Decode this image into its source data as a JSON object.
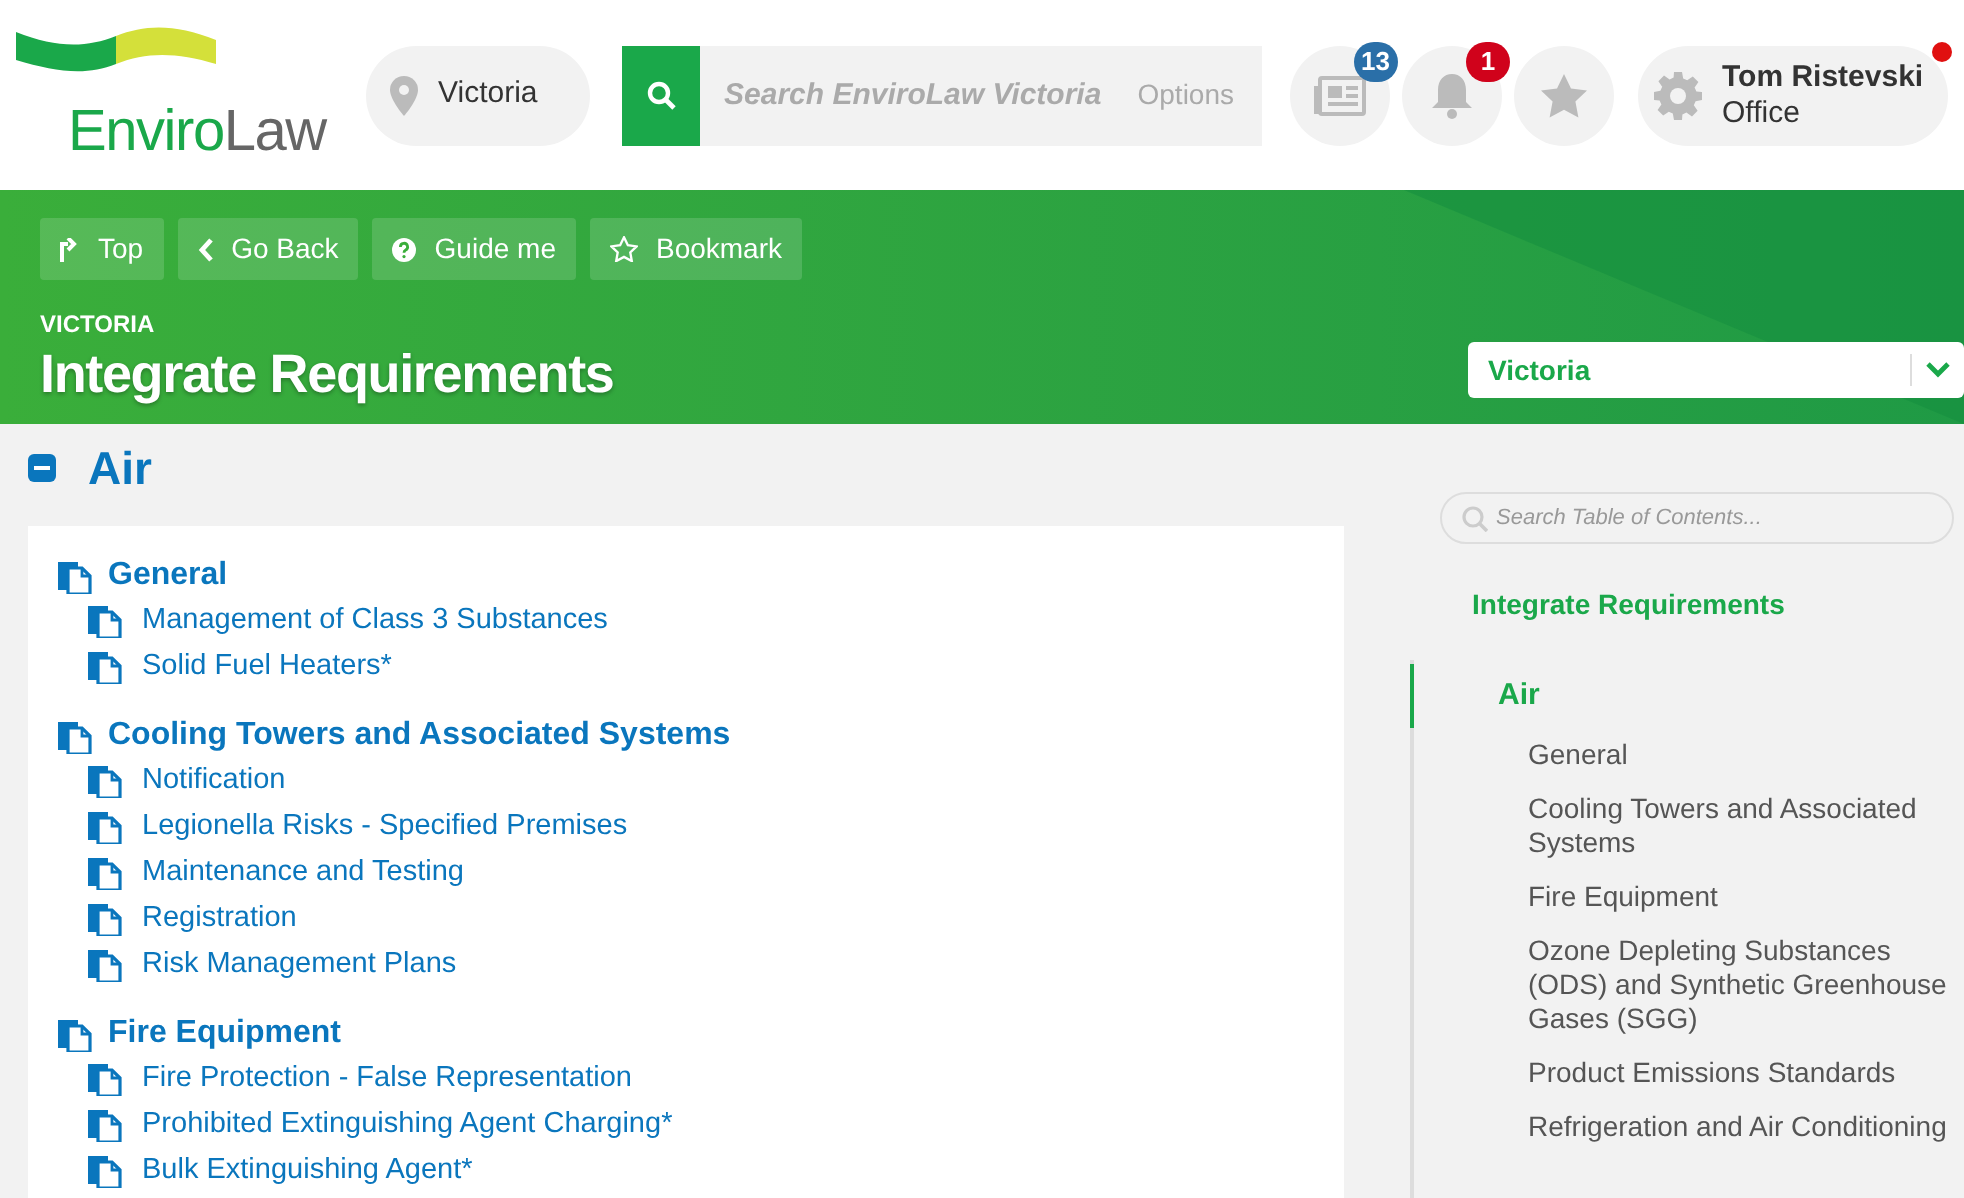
{
  "header": {
    "logo": {
      "part_1": "Enviro",
      "part_2": "Law"
    },
    "location": "Victoria",
    "search": {
      "placeholder": "Search EnviroLaw Victoria",
      "options": "Options"
    },
    "icons": [
      {
        "kind": "news",
        "badge": "13"
      },
      {
        "kind": "bell",
        "badge": "1"
      },
      {
        "kind": "star"
      }
    ],
    "user": {
      "name": "Tom Ristevski",
      "role": "Office",
      "online_dot": true
    }
  },
  "toolbar": [
    {
      "kind": "top",
      "label": "Top"
    },
    {
      "kind": "back",
      "label": "Go Back"
    },
    {
      "kind": "help",
      "label": "Guide me"
    },
    {
      "kind": "bookmark",
      "label": "Bookmark"
    }
  ],
  "banner": {
    "jurisdiction": "VICTORIA",
    "title": "Integrate Requirements",
    "dropdown": "Victoria"
  },
  "section": {
    "title": "Air",
    "expanded": true
  },
  "groups": [
    {
      "title": "General",
      "items": [
        "Management of Class 3 Substances",
        "Solid Fuel Heaters*"
      ]
    },
    {
      "title": "Cooling Towers and Associated Systems",
      "items": [
        "Notification",
        "Legionella Risks - Specified Premises",
        "Maintenance and Testing",
        "Registration",
        "Risk Management Plans"
      ]
    },
    {
      "title": "Fire Equipment",
      "items": [
        "Fire Protection - False Representation",
        "Prohibited Extinguishing Agent Charging*",
        "Bulk Extinguishing Agent*"
      ]
    }
  ],
  "toc": {
    "search_placeholder": "Search Table of Contents...",
    "heading": "Integrate Requirements",
    "items": [
      {
        "label": "Air",
        "selected": true,
        "children": [
          {
            "label": "General",
            "selected": false
          },
          {
            "label": "Cooling Towers and Associated Systems",
            "selected": false
          },
          {
            "label": "Fire Equipment",
            "selected": false
          },
          {
            "label": "Ozone Depleting Substances (ODS) and Synthetic Greenhouse Gases (SGG)",
            "selected": false
          },
          {
            "label": "Product Emissions Standards",
            "selected": false
          },
          {
            "label": "Refrigeration and Air Conditioning",
            "selected": false
          }
        ]
      }
    ]
  }
}
